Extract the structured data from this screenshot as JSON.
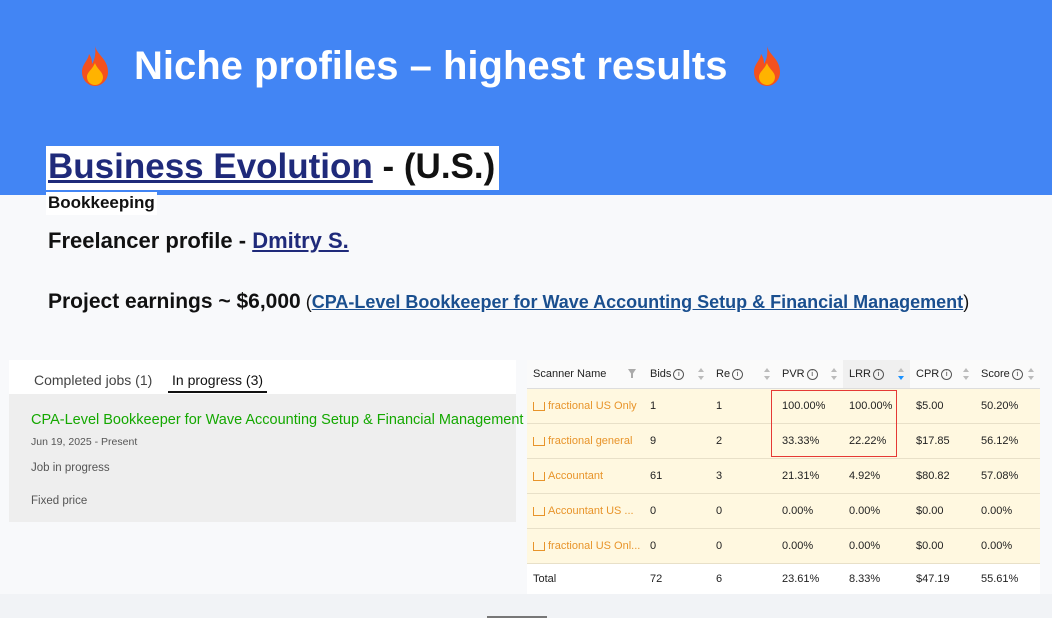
{
  "slide": {
    "title": "Niche profiles – highest results",
    "icon_left": "fire-icon",
    "icon_right": "fire-icon",
    "banner_color": "#4285f4"
  },
  "company": {
    "name": "Business Evolution",
    "suffix": " - (U.S.)",
    "category": "Bookkeeping"
  },
  "freelancer": {
    "label": "Freelancer profile - ",
    "name": "Dmitry S."
  },
  "earnings": {
    "label": "Project earnings ~ $6,000",
    "paren_open": " (",
    "project_link": "CPA-Level Bookkeeper for Wave Accounting Setup & Financial Management",
    "paren_close": ")"
  },
  "jobs_panel": {
    "tabs": [
      {
        "label": "Completed jobs (1)",
        "active": false
      },
      {
        "label": "In progress (3)",
        "active": true
      }
    ],
    "job": {
      "title": "CPA-Level Bookkeeper for Wave Accounting Setup & Financial Management",
      "date": "Jun 19, 2025 - Present",
      "status": "Job in progress",
      "price_type": "Fixed price",
      "title_color": "#14a800"
    }
  },
  "scanner_table": {
    "columns": [
      "Scanner Name",
      "Bids",
      "Re",
      "PVR",
      "LRR",
      "CPR",
      "Score"
    ],
    "rows": [
      {
        "name": "fractional US Only",
        "bids": "1",
        "re": "1",
        "pvr": "100.00%",
        "lrr": "100.00%",
        "cpr": "$5.00",
        "score": "50.20%"
      },
      {
        "name": "fractional general",
        "bids": "9",
        "re": "2",
        "pvr": "33.33%",
        "lrr": "22.22%",
        "cpr": "$17.85",
        "score": "56.12%"
      },
      {
        "name": "Accountant",
        "bids": "61",
        "re": "3",
        "pvr": "21.31%",
        "lrr": "4.92%",
        "cpr": "$80.82",
        "score": "57.08%"
      },
      {
        "name": "Accountant US ...",
        "bids": "0",
        "re": "0",
        "pvr": "0.00%",
        "lrr": "0.00%",
        "cpr": "$0.00",
        "score": "0.00%"
      },
      {
        "name": "fractional US Onl...",
        "bids": "0",
        "re": "0",
        "pvr": "0.00%",
        "lrr": "0.00%",
        "cpr": "$0.00",
        "score": "0.00%"
      }
    ],
    "total": {
      "name": "Total",
      "bids": "72",
      "re": "6",
      "pvr": "23.61%",
      "lrr": "8.33%",
      "cpr": "$47.19",
      "score": "55.61%"
    },
    "name_color": "#e8942a",
    "row_highlight_color": "#fff8e0",
    "box_color": "#e53935"
  }
}
